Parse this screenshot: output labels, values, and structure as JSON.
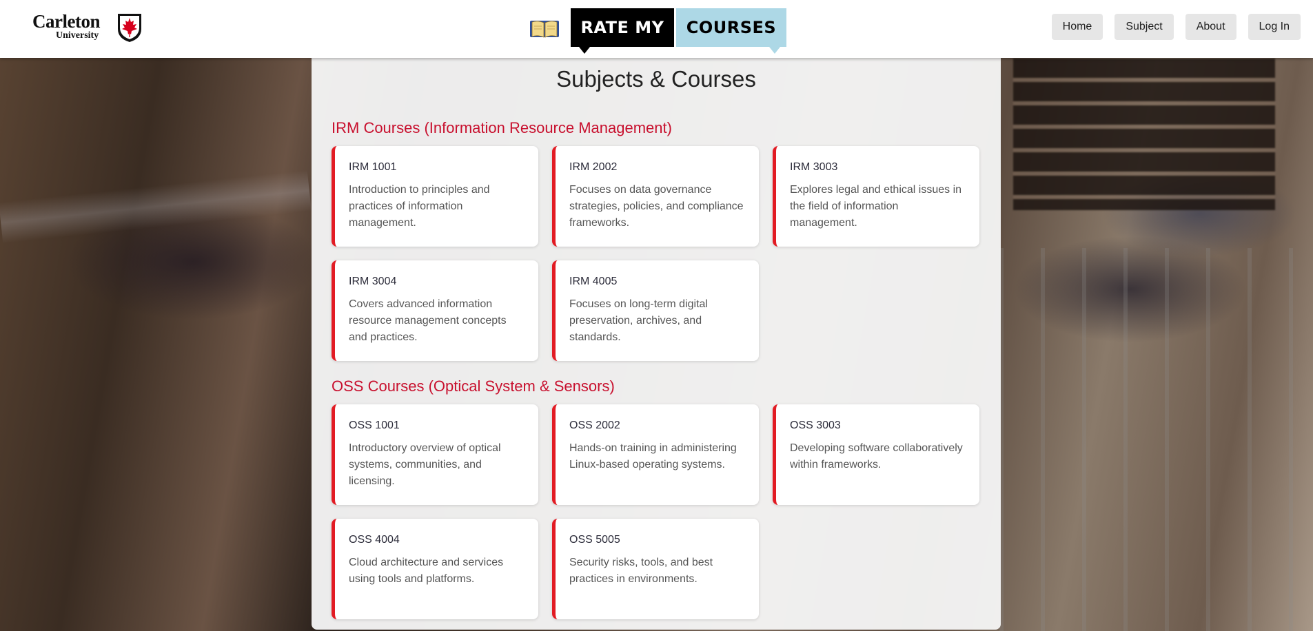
{
  "header": {
    "logo": {
      "name": "Carleton",
      "sub": "University"
    },
    "brand": {
      "part1": "RATE MY",
      "part2": "COURSES"
    },
    "nav": [
      {
        "label": "Home"
      },
      {
        "label": "Subject"
      },
      {
        "label": "About"
      },
      {
        "label": "Log In"
      }
    ]
  },
  "main": {
    "title": "Subjects & Courses",
    "sections": [
      {
        "title": "IRM Courses (Information Resource Management)",
        "courses": [
          {
            "code": "IRM 1001",
            "description": "Introduction to principles and practices of information management."
          },
          {
            "code": "IRM 2002",
            "description": "Focuses on data governance strategies, policies, and compliance frameworks."
          },
          {
            "code": "IRM 3003",
            "description": "Explores legal and ethical issues in the field of information management."
          },
          {
            "code": "IRM 3004",
            "description": "Covers advanced information resource management concepts and practices."
          },
          {
            "code": "IRM 4005",
            "description": "Focuses on long-term digital preservation, archives, and standards."
          }
        ]
      },
      {
        "title": "OSS Courses (Optical System & Sensors)",
        "courses": [
          {
            "code": "OSS 1001",
            "description": "Introductory overview of optical systems, communities, and licensing."
          },
          {
            "code": "OSS 2002",
            "description": "Hands-on training in administering Linux-based operating systems."
          },
          {
            "code": "OSS 3003",
            "description": "Developing software collaboratively within frameworks."
          },
          {
            "code": "OSS 4004",
            "description": "Cloud architecture and services using tools and platforms."
          },
          {
            "code": "OSS 5005",
            "description": "Security risks, tools, and best practices in environments."
          }
        ]
      }
    ]
  },
  "colors": {
    "accent": "#c8102e",
    "card_border": "#e21b23",
    "brand_black": "#000000",
    "brand_blue": "#add8e6"
  },
  "icons": {
    "brand": "open-book-icon",
    "logo": "maple-leaf-shield-icon"
  }
}
